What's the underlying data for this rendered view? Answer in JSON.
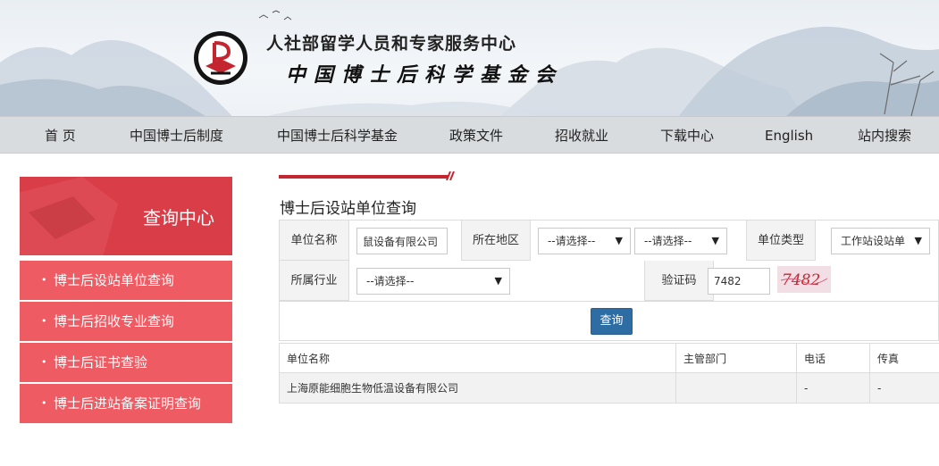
{
  "header": {
    "org_title": "人社部留学人员和专家服务中心",
    "org_subtitle": "中国博士后科学基金会"
  },
  "nav": {
    "items": [
      {
        "label": "首 页"
      },
      {
        "label": "中国博士后制度"
      },
      {
        "label": "中国博士后科学基金"
      },
      {
        "label": "政策文件"
      },
      {
        "label": "招收就业"
      },
      {
        "label": "下载中心"
      },
      {
        "label": "English"
      },
      {
        "label": "站内搜索"
      }
    ]
  },
  "sidebar": {
    "heading": "查询中心",
    "items": [
      {
        "label": "博士后设站单位查询"
      },
      {
        "label": "博士后招收专业查询"
      },
      {
        "label": "博士后证书查验"
      },
      {
        "label": "博士后进站备案证明查询"
      }
    ]
  },
  "main": {
    "title": "博士后设站单位查询",
    "form": {
      "unit_name_label": "单位名称",
      "unit_name_value": "鼠设备有限公司",
      "region_label": "所在地区",
      "region_select_1": "--请选择--",
      "region_select_2": "--请选择--",
      "unit_type_label": "单位类型",
      "unit_type_value": "工作站设站单",
      "industry_label": "所属行业",
      "industry_value": "--请选择--",
      "captcha_label": "验证码",
      "captcha_input": "7482",
      "captcha_image_text": "7482",
      "query_button": "查询"
    },
    "table": {
      "headers": [
        "单位名称",
        "主管部门",
        "电话",
        "传真"
      ],
      "rows": [
        [
          "上海原能细胞生物低温设备有限公司",
          "",
          "-",
          "-"
        ]
      ]
    }
  },
  "colors": {
    "sidebar_head": "#d93e48",
    "sidebar_item": "#ef5b63",
    "nav_bg": "#d9dcdf",
    "button": "#2e6da4",
    "accent_red": "#c4262f"
  }
}
